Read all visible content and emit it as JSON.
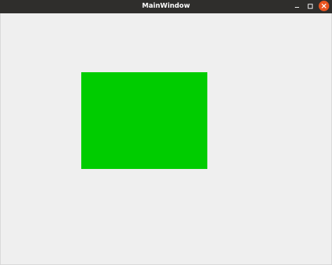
{
  "window": {
    "title": "MainWindow"
  },
  "colors": {
    "titlebar": "#2f2e2c",
    "close_button": "#e95420",
    "background": "#efefef",
    "shape": "#00cc00"
  },
  "icons": {
    "minimize": "minimize-icon",
    "maximize": "maximize-icon",
    "close": "close-icon"
  }
}
